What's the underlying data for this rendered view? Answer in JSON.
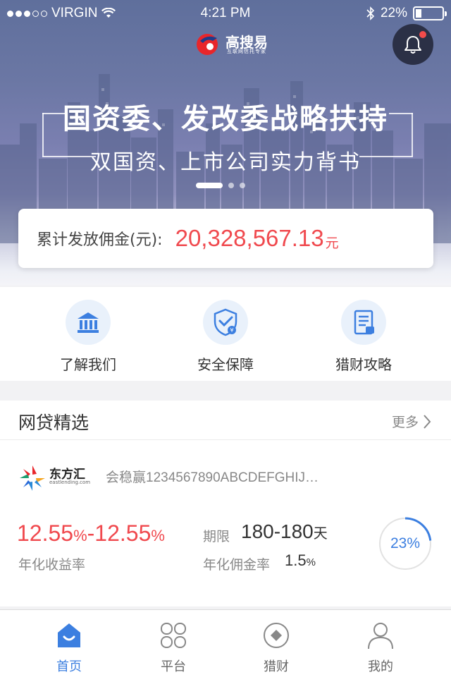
{
  "status_bar": {
    "carrier": "VIRGIN",
    "time": "4:21 PM",
    "battery": "22%",
    "battery_level": 0.22
  },
  "header": {
    "logo_text": "高搜易",
    "logo_sub": "互联网信托专家",
    "notification_icon": "bell-icon"
  },
  "banner": {
    "title": "国资委、发改委战略扶持",
    "subtitle": "双国资、上市公司实力背书",
    "slide_count": 3,
    "active_slide": 0
  },
  "total": {
    "label": "累计发放佣金(元):",
    "value": "20,328,567.13",
    "unit": "元"
  },
  "quick_links": [
    {
      "label": "了解我们",
      "icon": "bank-icon"
    },
    {
      "label": "安全保障",
      "icon": "shield-icon"
    },
    {
      "label": "猎财攻略",
      "icon": "document-icon"
    }
  ],
  "section": {
    "title": "网贷精选",
    "more": "更多",
    "product": {
      "platform_name": "东方汇",
      "platform_domain": "eastlending.com",
      "product_name": "会稳赢1234567890ABCDEFGHIJ…",
      "rate_min": "12.55",
      "rate_max": "12.55",
      "rate_unit": "%",
      "rate_label": "年化收益率",
      "term_label": "期限",
      "term_value": "180-180",
      "term_unit": "天",
      "commission_label": "年化佣金率",
      "commission_value": "1.5",
      "commission_unit": "%",
      "progress_text": "23%",
      "progress": 0.23
    }
  },
  "tabbar": [
    {
      "label": "首页",
      "icon": "home-icon",
      "active": true
    },
    {
      "label": "平台",
      "icon": "grid-icon",
      "active": false
    },
    {
      "label": "猎财",
      "icon": "coin-icon",
      "active": false
    },
    {
      "label": "我的",
      "icon": "user-icon",
      "active": false
    }
  ],
  "colors": {
    "accent": "#3c7fe0",
    "highlight": "#f0494e",
    "logo_red": "#e8262b"
  }
}
